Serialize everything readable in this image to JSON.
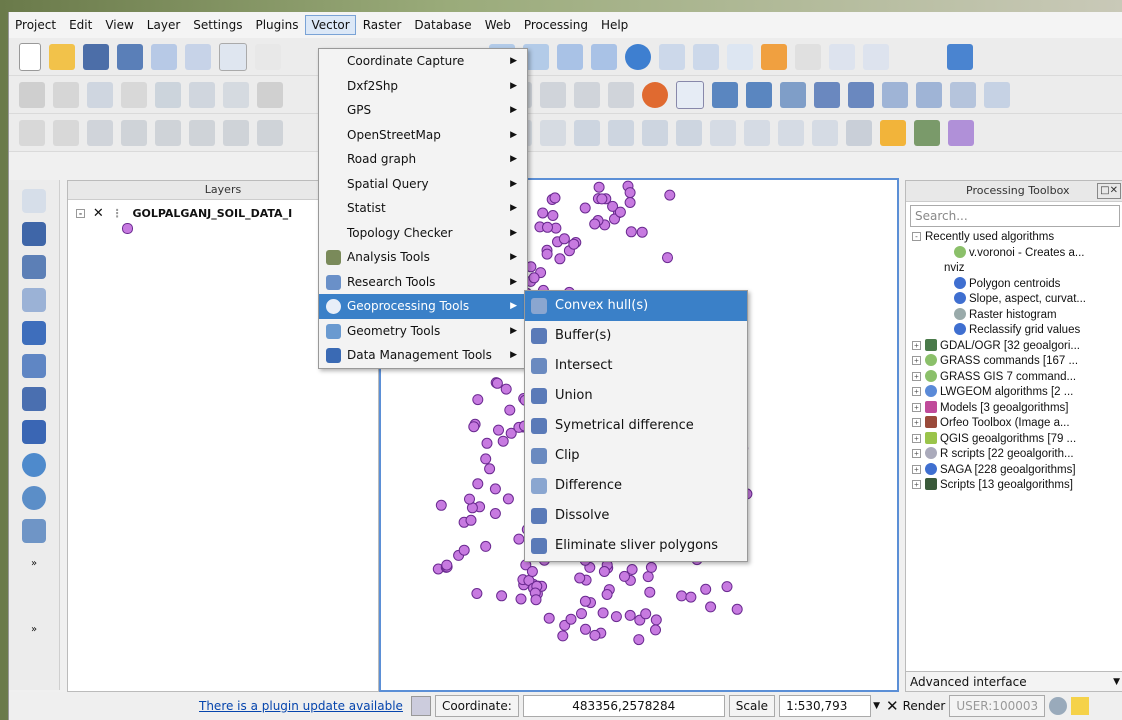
{
  "menubar": [
    "Project",
    "Edit",
    "View",
    "Layer",
    "Settings",
    "Plugins",
    "Vector",
    "Raster",
    "Database",
    "Web",
    "Processing",
    "Help"
  ],
  "active_menu": "Vector",
  "vector_menu": [
    {
      "label": "Coordinate Capture",
      "arrow": true,
      "icon": ""
    },
    {
      "label": "Dxf2Shp",
      "arrow": true,
      "icon": ""
    },
    {
      "label": "GPS",
      "arrow": true,
      "icon": ""
    },
    {
      "label": "OpenStreetMap",
      "arrow": true,
      "icon": ""
    },
    {
      "label": "Road graph",
      "arrow": true,
      "icon": ""
    },
    {
      "label": "Spatial Query",
      "arrow": true,
      "icon": ""
    },
    {
      "label": "Statist",
      "arrow": true,
      "icon": ""
    },
    {
      "label": "Topology Checker",
      "arrow": true,
      "icon": ""
    },
    {
      "label": "Analysis Tools",
      "arrow": true,
      "icon": "analysis-tools-icon"
    },
    {
      "label": "Research Tools",
      "arrow": true,
      "icon": "research-tools-icon"
    },
    {
      "label": "Geoprocessing Tools",
      "arrow": true,
      "icon": "geoprocessing-tools-icon",
      "selected": true
    },
    {
      "label": "Geometry Tools",
      "arrow": true,
      "icon": "geometry-tools-icon"
    },
    {
      "label": "Data Management Tools",
      "arrow": true,
      "icon": "data-management-tools-icon"
    }
  ],
  "geoprocessing_submenu": [
    {
      "label": "Convex hull(s)",
      "selected": true
    },
    {
      "label": "Buffer(s)"
    },
    {
      "label": "Intersect"
    },
    {
      "label": "Union"
    },
    {
      "label": "Symetrical difference"
    },
    {
      "label": "Clip"
    },
    {
      "label": "Difference"
    },
    {
      "label": "Dissolve"
    },
    {
      "label": "Eliminate sliver polygons"
    }
  ],
  "layers": {
    "title": "Layers",
    "items": [
      {
        "name": "GOLPALGANJ_SOIL_DATA_I"
      }
    ]
  },
  "processing": {
    "title": "Processing Toolbox",
    "search_placeholder": "Search...",
    "recent_header": "Recently used algorithms",
    "recent": [
      "v.voronoi - Creates a...",
      "nviz",
      "Polygon centroids",
      "Slope, aspect, curvat...",
      "Raster histogram",
      "Reclassify grid values"
    ],
    "providers": [
      "GDAL/OGR [32 geoalgori...",
      "GRASS commands [167 ...",
      "GRASS GIS 7 command...",
      "LWGEOM algorithms [2 ...",
      "Models [3 geoalgorithms]",
      "Orfeo Toolbox (Image a...",
      "QGIS geoalgorithms [79 ...",
      "R scripts [22 geoalgorith...",
      "SAGA [228 geoalgorithms]",
      "Scripts [13 geoalgorithms]"
    ],
    "advanced": "Advanced interface"
  },
  "status": {
    "plugin_update": "There is a plugin update available",
    "coordinate_label": "Coordinate:",
    "coordinate_value": "483356,2578284",
    "scale_label": "Scale",
    "scale_value": "1:530,793",
    "render_label": "Render",
    "user_value": "USER:100003"
  },
  "colors": {
    "point_fill": "#c77ae0",
    "point_stroke": "#6a2a90",
    "selection": "#3a80c8"
  }
}
